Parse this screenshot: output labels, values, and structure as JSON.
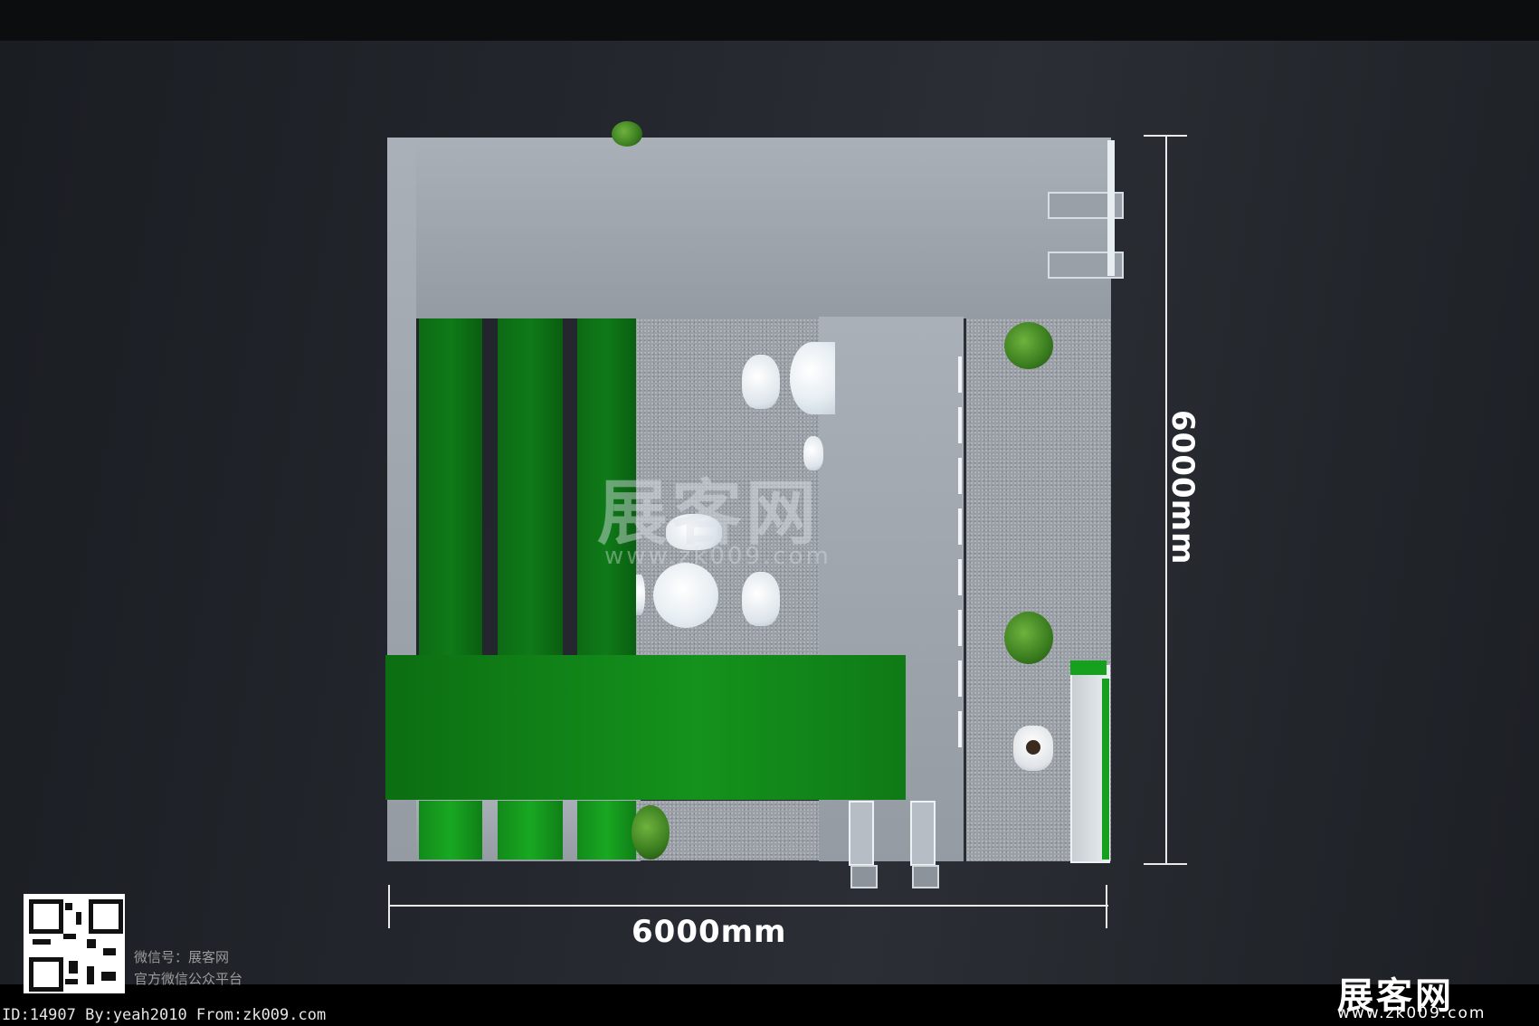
{
  "dimensions": {
    "width_label": "6000mm",
    "height_label": "6000mm"
  },
  "watermark": {
    "brand_cn": "展客网",
    "url": "www.zk009.com"
  },
  "qr_caption": {
    "line1": "微信号：展客网",
    "line2": "官方微信公众平台"
  },
  "footer": {
    "id_line": "ID:14907 By:yeah2010 From:zk009.com",
    "logo_cn": "展客网",
    "logo_url": "www.zk009.com"
  },
  "colors": {
    "booth_green": "#0f7a18",
    "wall_grey": "#a2a8af",
    "background": "#23272d"
  }
}
